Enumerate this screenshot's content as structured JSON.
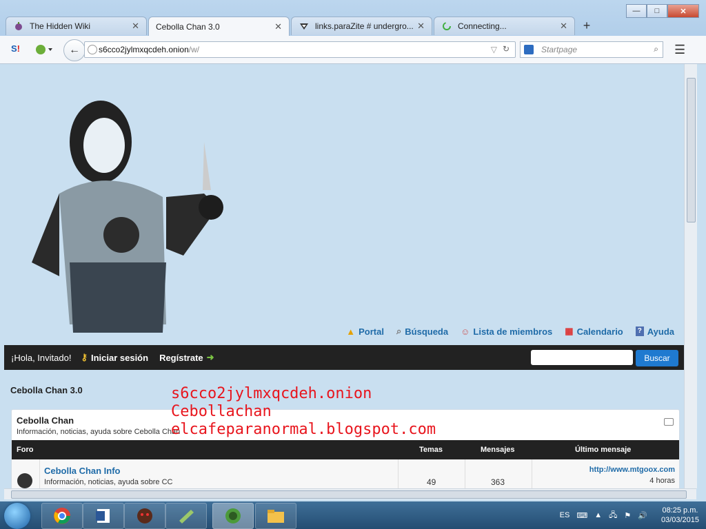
{
  "tabs": [
    {
      "title": "The Hidden Wiki",
      "icon": "onion-icon",
      "active": false
    },
    {
      "title": "Cebolla Chan 3.0",
      "icon": "",
      "active": true
    },
    {
      "title": "links.paraZite # undergro...",
      "icon": "parazite-icon",
      "active": false
    },
    {
      "title": "Connecting...",
      "icon": "loading-spinner-icon",
      "active": false
    }
  ],
  "address": {
    "host": "s6cco2jylmxqcdeh.onion",
    "path": "/w/"
  },
  "search": {
    "placeholder": "Startpage"
  },
  "page": {
    "nav_links": [
      {
        "label": "Portal",
        "icon": "bell-icon"
      },
      {
        "label": "Búsqueda",
        "icon": "magnifier-icon"
      },
      {
        "label": "Lista de miembros",
        "icon": "members-icon"
      },
      {
        "label": "Calendario",
        "icon": "calendar-icon"
      },
      {
        "label": "Ayuda",
        "icon": "help-icon"
      }
    ],
    "greeting": "¡Hola, Invitado!",
    "login": "Iniciar sesión",
    "register": "Regístrate",
    "search_button": "Buscar",
    "board_title": "Cebolla Chan 3.0",
    "category": {
      "name": "Cebolla Chan",
      "description": "Información, noticias, ayuda sobre Cebolla Chan"
    },
    "table_headers": {
      "forum": "Foro",
      "topics": "Temas",
      "posts": "Mensajes",
      "last": "Último mensaje"
    },
    "forum_row": {
      "name": "Cebolla Chan Info",
      "description": "Información, noticias, ayuda sobre CC",
      "topics": "49",
      "posts": "363",
      "last_link": "http://www.mtgoox.com",
      "last_time": "4 horas"
    },
    "overlay_lines": [
      "s6cco2jylmxqcdeh.onion",
      "Cebollachan",
      "elcafeparanormal.blogspot.com"
    ]
  },
  "tray": {
    "lang": "ES",
    "time": "08:25 p.m.",
    "date": "03/03/2015"
  },
  "colors": {
    "link": "#1f6ba8",
    "overlay": "#e8151d",
    "bar": "#222222",
    "button": "#1f7ad0"
  }
}
